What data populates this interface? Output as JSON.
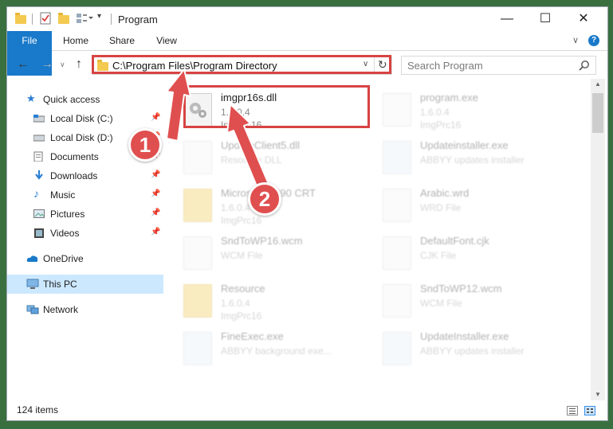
{
  "window": {
    "title": "Program",
    "controls": {
      "minimize": "—",
      "maximize": "☐",
      "close": "✕"
    }
  },
  "ribbon": {
    "tabs": [
      "File",
      "Home",
      "Share",
      "View"
    ],
    "help": "?",
    "expand": "∨"
  },
  "nav": {
    "back": "←",
    "forward": "→",
    "recent": "∨",
    "up": "↑",
    "address": "C:\\Program Files\\Program Directory",
    "address_dropdown": "∨",
    "refresh": "↻",
    "search_placeholder": "Search Program"
  },
  "sidebar": {
    "items": [
      {
        "label": "Quick access",
        "icon": "star-icon",
        "pinned": false
      },
      {
        "label": "Local Disk (C:)",
        "icon": "drive-icon",
        "pinned": true
      },
      {
        "label": "Local Disk (D:)",
        "icon": "drive-icon",
        "pinned": true
      },
      {
        "label": "Documents",
        "icon": "documents-icon",
        "pinned": true
      },
      {
        "label": "Downloads",
        "icon": "download-icon",
        "pinned": true
      },
      {
        "label": "Music",
        "icon": "music-icon",
        "pinned": true
      },
      {
        "label": "Pictures",
        "icon": "pictures-icon",
        "pinned": true
      },
      {
        "label": "Videos",
        "icon": "videos-icon",
        "pinned": true
      },
      {
        "label": "OneDrive",
        "icon": "cloud-icon",
        "pinned": false
      },
      {
        "label": "This PC",
        "icon": "computer-icon",
        "pinned": false,
        "selected": true
      },
      {
        "label": "Network",
        "icon": "network-icon",
        "pinned": false
      }
    ],
    "pin_glyph": "📌"
  },
  "files": [
    {
      "name": "imgpr16s.dll",
      "line2": "1.6.0.4",
      "line3": "ImgPrc16",
      "highlighted": true
    },
    {
      "name": "program.exe",
      "line2": "1.6.0.4",
      "line3": "ImgPrc16"
    },
    {
      "name": "UpdateClient5.dll",
      "line2": "Resource DLL",
      "line3": ""
    },
    {
      "name": "Updateinstaller.exe",
      "line2": "ABBYY updates installer",
      "line3": ""
    },
    {
      "name": "Microsoft VC90 CRT",
      "line2": "1.6.0.4",
      "line3": "ImgPrc16"
    },
    {
      "name": "Arabic.wrd",
      "line2": "WRD File",
      "line3": ""
    },
    {
      "name": "SndToWP16.wcm",
      "line2": "WCM File",
      "line3": ""
    },
    {
      "name": "DefaultFont.cjk",
      "line2": "CJK File",
      "line3": ""
    },
    {
      "name": "Resource",
      "line2": "1.6.0.4",
      "line3": "ImgPrc16"
    },
    {
      "name": "SndToWP12.wcm",
      "line2": "WCM File",
      "line3": ""
    },
    {
      "name": "FineExec.exe",
      "line2": "ABBYY background exe...",
      "line3": ""
    },
    {
      "name": "UpdateInstaller.exe",
      "line2": "ABBYY updates installer",
      "line3": ""
    }
  ],
  "status": {
    "item_count": "124 items"
  },
  "annotations": [
    {
      "label": "1",
      "color": "#e04f4f"
    },
    {
      "label": "2",
      "color": "#e04f4f"
    }
  ],
  "colors": {
    "accent": "#1979ca",
    "annotation": "#d84343",
    "selected": "#cce8ff"
  }
}
